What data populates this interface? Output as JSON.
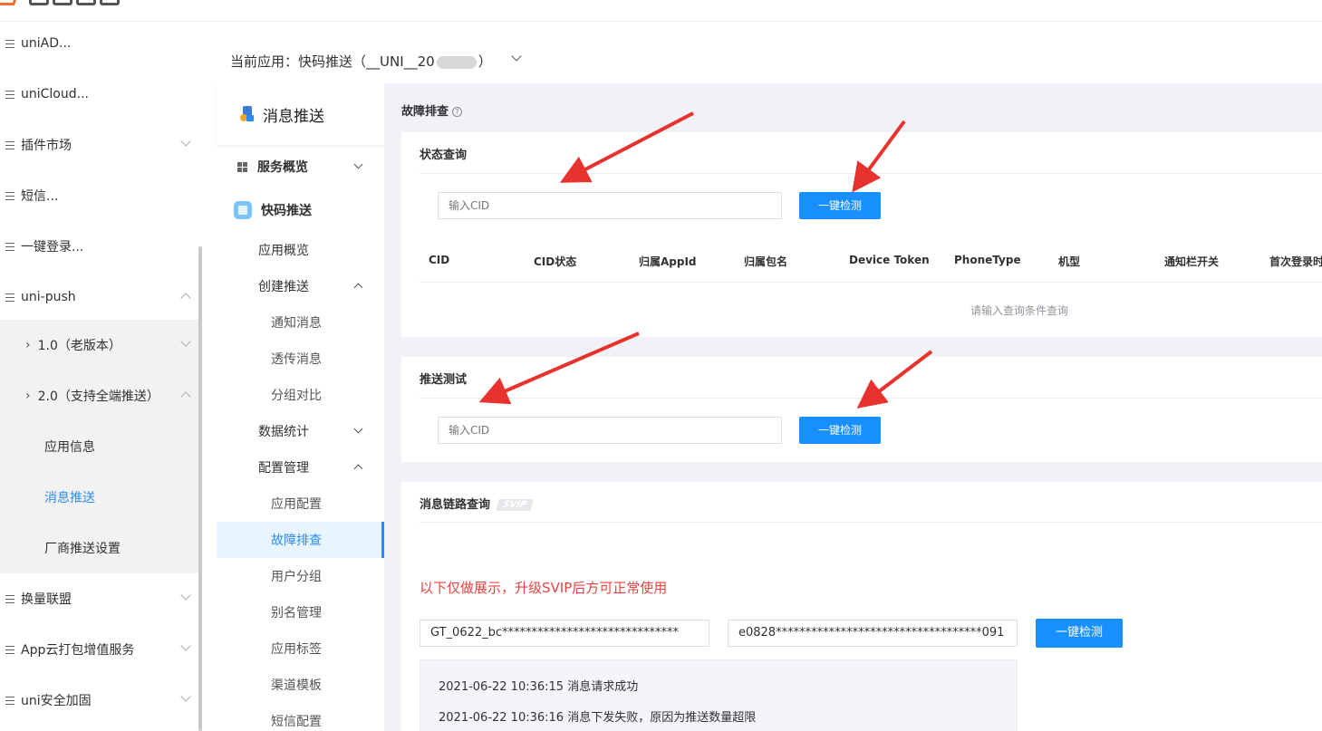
{
  "logo": {
    "text": ""
  },
  "sidebar": {
    "items": [
      {
        "label": "uniAD..."
      },
      {
        "label": "uniCloud..."
      },
      {
        "label": "插件市场"
      },
      {
        "label": "短信..."
      },
      {
        "label": "一键登录..."
      },
      {
        "label": "uni-push"
      },
      {
        "label": "1.0（老版本）"
      },
      {
        "label": "2.0（支持全端推送）"
      },
      {
        "label": "应用信息"
      },
      {
        "label": "消息推送"
      },
      {
        "label": "厂商推送设置"
      },
      {
        "label": "换量联盟"
      },
      {
        "label": "App云打包增值服务"
      },
      {
        "label": "uni安全加固"
      }
    ]
  },
  "app_header": {
    "prefix": "当前应用：快码推送（__UNI__20",
    "suffix": "）"
  },
  "inner_menu": {
    "title": "消息推送",
    "items": [
      {
        "label": "服务概览"
      },
      {
        "label": "快码推送"
      },
      {
        "label": "应用概览"
      },
      {
        "label": "创建推送"
      },
      {
        "label": "通知消息"
      },
      {
        "label": "透传消息"
      },
      {
        "label": "分组对比"
      },
      {
        "label": "数据统计"
      },
      {
        "label": "配置管理"
      },
      {
        "label": "应用配置"
      },
      {
        "label": "故障排查"
      },
      {
        "label": "用户分组"
      },
      {
        "label": "别名管理"
      },
      {
        "label": "应用标签"
      },
      {
        "label": "渠道模板"
      },
      {
        "label": "短信配置"
      }
    ]
  },
  "main": {
    "section_title": "故障排查",
    "help_icon": "?",
    "status_query": {
      "title": "状态查询",
      "cid_placeholder": "输入CID",
      "button": "一键检测",
      "columns": [
        "CID",
        "CID状态",
        "归属AppId",
        "归属包名",
        "Device Token",
        "PhoneType",
        "机型",
        "通知栏开关",
        "首次登录时"
      ],
      "empty_text": "请输入查询条件查询"
    },
    "push_test": {
      "title": "推送测试",
      "cid_placeholder": "输入CID",
      "button": "一键检测"
    },
    "link_query": {
      "title": "消息链路查询",
      "badge": "SVIP",
      "notice": "以下仅做展示，升级SVIP后方可正常使用",
      "input1": "GT_0622_bc******************************",
      "input2": "e0828***********************************091",
      "button": "一键检测",
      "logs": [
        "2021-06-22 10:36:15 消息请求成功",
        "2021-06-22 10:36:16 消息下发失败，原因为推送数量超限"
      ]
    }
  },
  "colors": {
    "accent": "#1890ff",
    "annotation": "#e8322e",
    "notice": "#e64340"
  }
}
